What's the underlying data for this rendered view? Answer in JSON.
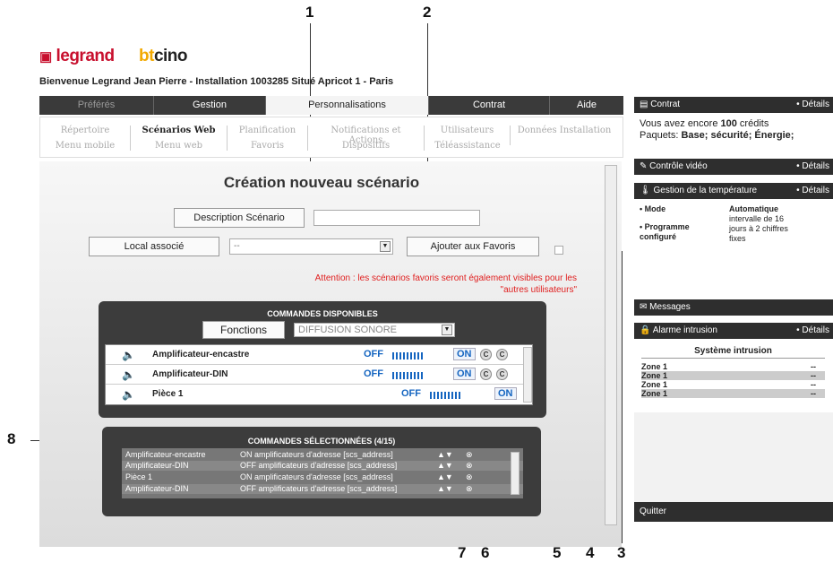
{
  "brand": {
    "legrand": "legrand",
    "bticino_b": "bt",
    "bticino_rest": "cino"
  },
  "welcome": "Bienvenue Legrand Jean Pierre - Installation 1003285 Situé Apricot 1 - Paris",
  "tabs": [
    "Préférés",
    "Gestion",
    "Personnalisations",
    "Contrat",
    "Aide"
  ],
  "subnav": {
    "row1": [
      "Répertoire",
      "Scénarios Web",
      "Planification",
      "Notifications et Actions",
      "Utilisateurs",
      "Données Installation"
    ],
    "row2": [
      "Menu mobile",
      "Menu web",
      "Favoris",
      "Dispositifs",
      "Téléassistance"
    ]
  },
  "main": {
    "title": "Création nouveau scénario",
    "description_button": "Description Scénario",
    "local_button": "Local associé",
    "local_select": "--",
    "favorites_button": "Ajouter aux Favoris",
    "warning": "Attention : les scénarios favoris seront également visibles pour les \"autres utilisateurs\""
  },
  "available": {
    "header": "COMMANDES DISPONIBLES",
    "functions_label": "Fonctions",
    "functions_select": "DIFFUSION SONORE",
    "rows": [
      {
        "name": "Amplificateur-encastre",
        "off": "OFF",
        "on": "ON"
      },
      {
        "name": "Amplificateur-DIN",
        "off": "OFF",
        "on": "ON"
      },
      {
        "name": "Pièce 1",
        "off": "OFF",
        "on": "ON"
      }
    ]
  },
  "selected": {
    "header": "COMMANDES SÉLECTIONNÉES (4/15)",
    "rows": [
      {
        "name": "Amplificateur-encastre",
        "cmd": "ON amplificateurs d'adresse [scs_address]"
      },
      {
        "name": "Amplificateur-DIN",
        "cmd": "OFF amplificateurs d'adresse  [scs_address]"
      },
      {
        "name": "Pièce 1",
        "cmd": "ON amplificateurs d'adresse [scs_address]"
      },
      {
        "name": "Amplificateur-DIN",
        "cmd": "OFF amplificateurs d'adresse [scs_address]"
      }
    ]
  },
  "sidebar": {
    "contrat": {
      "title": "Contrat",
      "details": "• Détails",
      "line1_pre": "Vous avez encore ",
      "line1_bold": "100",
      "line1_post": " crédits",
      "line2_pre": "Paquets: ",
      "line2_bold": "Base; sécurité; Énergie;"
    },
    "video": {
      "title": "Contrôle vidéo",
      "details": "• Détails"
    },
    "temperature": {
      "title": "Gestion de la température",
      "details": "• Détails",
      "mode_label": "• Mode",
      "mode_value": "Automatique",
      "prog_label": "• Programme configuré",
      "prog_value": "intervalle de 16 jours à 2 chiffres fixes"
    },
    "messages": {
      "title": "Messages"
    },
    "alarme": {
      "title": "Alarme intrusion",
      "details": "• Détails",
      "system": "Système intrusion",
      "zones": [
        {
          "name": "Zone 1",
          "val": "--"
        },
        {
          "name": "Zone 1",
          "val": "--"
        },
        {
          "name": "Zone 1",
          "val": "--"
        },
        {
          "name": "Zone 1",
          "val": "--"
        }
      ]
    },
    "quit": "Quitter"
  },
  "callouts": [
    "1",
    "2",
    "3",
    "4",
    "5",
    "6",
    "7",
    "8"
  ]
}
